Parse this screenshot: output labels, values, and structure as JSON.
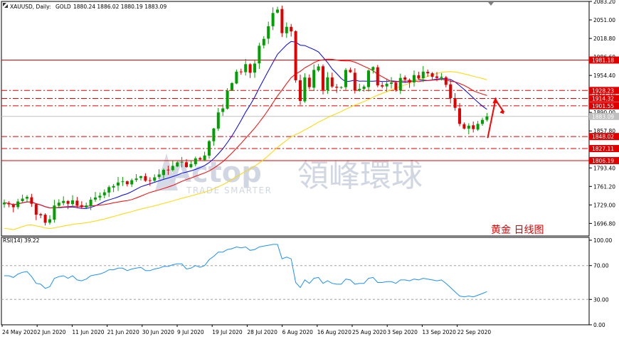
{
  "header": {
    "symbol": "XAUUSD, Daily:",
    "name": "GOLD",
    "ohlc": "1880.24 1886.02 1880.19 1883.09"
  },
  "rsi_header": "RSI(14) 39.22",
  "annotation": "黄金   日线图",
  "watermark": {
    "brand": "Actop",
    "cn": "領峰環球",
    "tagline": "TRADE SMARTER"
  },
  "colors": {
    "bull": "#00a000",
    "bear": "#e00000",
    "ma_fast": "#0000ff",
    "ma_mid": "#ff0000",
    "ma_slow": "#ffd700",
    "level": "#e00000",
    "rsi": "#1e90ff",
    "arrow": "#ff0000",
    "current_label": "#c0c0c0",
    "level_label": "#e00000"
  },
  "icons": {
    "arrows": "corner-arrows-icon"
  },
  "chart_data": [
    {
      "type": "candlestick",
      "title": "XAUUSD, Daily",
      "ylim": [
        1675,
        2083.2
      ],
      "yticks": [
        "2083.20",
        "2051.00",
        "2018.80",
        "1986.60",
        "1954.40",
        "1922.20",
        "1890.00",
        "1857.80",
        "1825.60",
        "1793.40",
        "1761.20",
        "1729.00",
        "1696.80"
      ],
      "x_labels": [
        "24 May 2020",
        "2 Jun 2020",
        "11 Jun 2020",
        "21 Jun 2020",
        "30 Jun 2020",
        "9 Jul 2020",
        "19 Jul 2020",
        "28 Jul 2020",
        "6 Aug 2020",
        "16 Aug 2020",
        "25 Aug 2020",
        "3 Sep 2020",
        "13 Sep 2020",
        "22 Sep 2020"
      ],
      "levels": [
        {
          "value": 1981.18,
          "label": "1981.18",
          "style": "solid"
        },
        {
          "value": 1928.23,
          "label": "1928.23",
          "style": "dashdot"
        },
        {
          "value": 1914.32,
          "label": "1914.32",
          "style": "dashdot"
        },
        {
          "value": 1901.55,
          "label": "1901.55",
          "style": "dashdot"
        },
        {
          "value": 1848.02,
          "label": "1848.02",
          "style": "dashdot"
        },
        {
          "value": 1827.11,
          "label": "1827.11",
          "style": "dashdot"
        },
        {
          "value": 1806.19,
          "label": "1806.19",
          "style": "solid"
        }
      ],
      "current_price": {
        "value": 1883.09,
        "label": "1883.09"
      },
      "closes": [
        1733,
        1730,
        1725,
        1735,
        1740,
        1743,
        1731,
        1712,
        1711,
        1698,
        1704,
        1728,
        1733,
        1736,
        1731,
        1737,
        1728,
        1725,
        1728,
        1738,
        1742,
        1745,
        1751,
        1760,
        1762,
        1768,
        1770,
        1765,
        1772,
        1775,
        1779,
        1771,
        1771,
        1777,
        1782,
        1790,
        1790,
        1797,
        1803,
        1804,
        1795,
        1800,
        1810,
        1808,
        1815,
        1840,
        1862,
        1890,
        1897,
        1928,
        1941,
        1961,
        1960,
        1974,
        1959,
        1975,
        2006,
        2018,
        2040,
        2063,
        2069,
        2028,
        2039,
        2031,
        1946,
        1910,
        1951,
        1934,
        1964,
        1970,
        1929,
        1951,
        1935,
        1933,
        1934,
        1964,
        1960,
        1928,
        1931,
        1935,
        1963,
        1969,
        1937,
        1935,
        1940,
        1942,
        1929,
        1950,
        1947,
        1942,
        1955,
        1949,
        1961,
        1958,
        1952,
        1950,
        1952,
        1938,
        1915,
        1898,
        1870,
        1862,
        1867,
        1861,
        1870,
        1877,
        1883
      ],
      "series": [
        {
          "name": "RSI(14)",
          "ylim": [
            0,
            100
          ],
          "yticks": [
            "100.00",
            "70.00",
            "30.00",
            "0.00"
          ],
          "levels": [
            70,
            30
          ],
          "values": [
            58,
            58,
            56,
            60,
            62,
            63,
            57,
            49,
            48,
            43,
            45,
            55,
            57,
            58,
            55,
            58,
            53,
            52,
            54,
            58,
            59,
            60,
            62,
            65,
            65,
            67,
            67,
            64,
            66,
            67,
            68,
            64,
            64,
            66,
            67,
            69,
            69,
            71,
            72,
            72,
            66,
            67,
            70,
            68,
            70,
            77,
            81,
            86,
            86,
            89,
            90,
            92,
            91,
            92,
            88,
            89,
            92,
            93,
            94,
            95,
            95,
            78,
            80,
            78,
            50,
            44,
            53,
            49,
            55,
            56,
            49,
            52,
            49,
            48,
            48,
            54,
            53,
            48,
            49,
            49,
            55,
            56,
            50,
            50,
            51,
            51,
            49,
            53,
            53,
            52,
            54,
            53,
            55,
            54,
            53,
            52,
            53,
            49,
            44,
            39,
            34,
            33,
            34,
            33,
            35,
            37,
            39.22
          ]
        }
      ]
    }
  ]
}
